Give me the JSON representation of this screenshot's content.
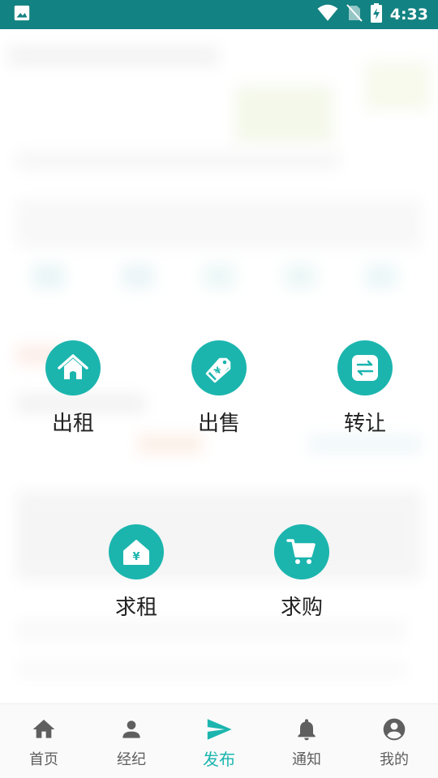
{
  "status_bar": {
    "time": "4:33",
    "icons": [
      "image-icon",
      "wifi-icon",
      "no-sim-icon",
      "battery-charging-icon"
    ]
  },
  "publish_menu": {
    "items": [
      {
        "label": "出租",
        "icon": "house-icon"
      },
      {
        "label": "出售",
        "icon": "price-tag-yen-icon"
      },
      {
        "label": "转让",
        "icon": "swap-arrows-icon"
      },
      {
        "label": "求租",
        "icon": "house-yen-icon"
      },
      {
        "label": "求购",
        "icon": "shopping-cart-icon"
      }
    ],
    "accent_color": "#1bb5ae"
  },
  "tab_bar": {
    "tabs": [
      {
        "label": "首页",
        "icon": "home-icon"
      },
      {
        "label": "经纪",
        "icon": "person-icon"
      },
      {
        "label": "发布",
        "icon": "send-icon",
        "active": true
      },
      {
        "label": "通知",
        "icon": "bell-icon"
      },
      {
        "label": "我的",
        "icon": "account-circle-icon"
      }
    ],
    "active_color": "#1bb5ae",
    "inactive_color": "#5f5f5f"
  },
  "colors": {
    "status_bar": "#138282"
  }
}
